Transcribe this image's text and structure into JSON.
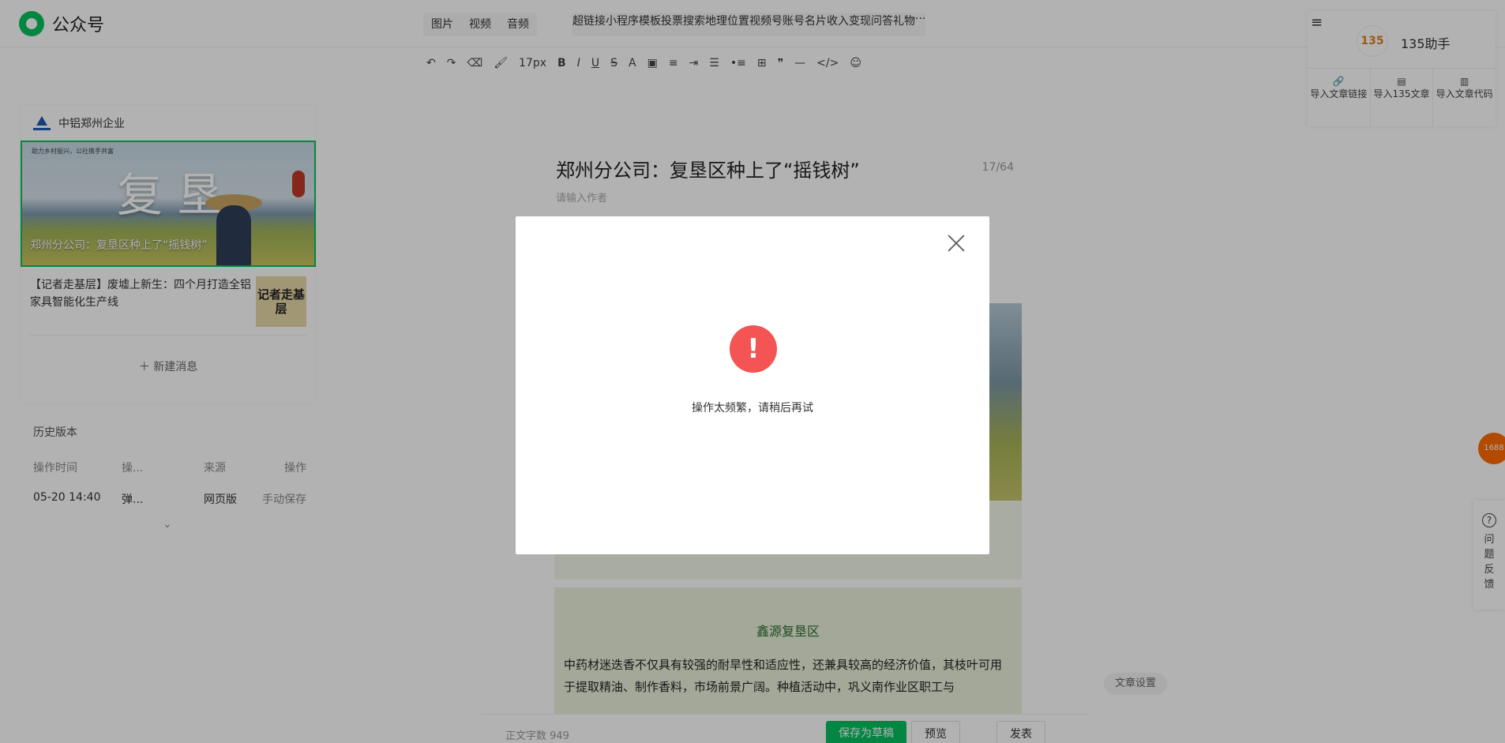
{
  "app": {
    "title": "公众号"
  },
  "menu": {
    "left": [
      "图片",
      "视频",
      "音频"
    ],
    "right": [
      "超链接",
      "小程序",
      "模板",
      "投票",
      "搜索",
      "地理位置",
      "视频号",
      "账号名片",
      "收入变现",
      "问答",
      "礼物"
    ],
    "more": "···"
  },
  "toolbar": {
    "font_size": "17px"
  },
  "account": {
    "name": "中铝郑州企业"
  },
  "articles": {
    "cover_small": "助力乡村振兴，公社携手共富",
    "cover_big": "复垦",
    "cover_caption": "郑州分公司：复垦区种上了“摇钱树”",
    "item2": "【记者走基层】废墟上新生：四个月打造全铝家具智能化生产线",
    "item2_thumb": "记者走基层",
    "new_message": "＋ 新建消息"
  },
  "history": {
    "title": "历史版本",
    "headers": [
      "操作时间",
      "操...",
      "来源",
      "操作"
    ],
    "rows": [
      [
        "05-20 14:40",
        "弹...",
        "网页版",
        "手动保存"
      ]
    ],
    "expand": "⌄"
  },
  "editor": {
    "title": "郑州分公司：复垦区种上了“摇钱树”",
    "count": "17/64",
    "author_placeholder": "请输入作者",
    "section_title": "鑫源复垦区",
    "section_body": "中药材迷迭香不仅具有较强的耐旱性和适应性，还兼具较高的经济价值，其枝叶可用于提取精油、制作香料，市场前景广阔。种植活动中，巩义南作业区职工与"
  },
  "footer": {
    "word_count": "正文字数 949",
    "save": "保存为草稿",
    "preview": "预览",
    "publish": "发表"
  },
  "article_settings": "文章设置",
  "helper": {
    "name": "135助手",
    "logo": "135",
    "actions": [
      "导入文章链接",
      "导入135文章",
      "导入文章代码"
    ]
  },
  "floating": {
    "badge": "1688",
    "feedback": "问题反馈"
  },
  "modal": {
    "message": "操作太频繁，请稍后再试",
    "icon": "!"
  }
}
